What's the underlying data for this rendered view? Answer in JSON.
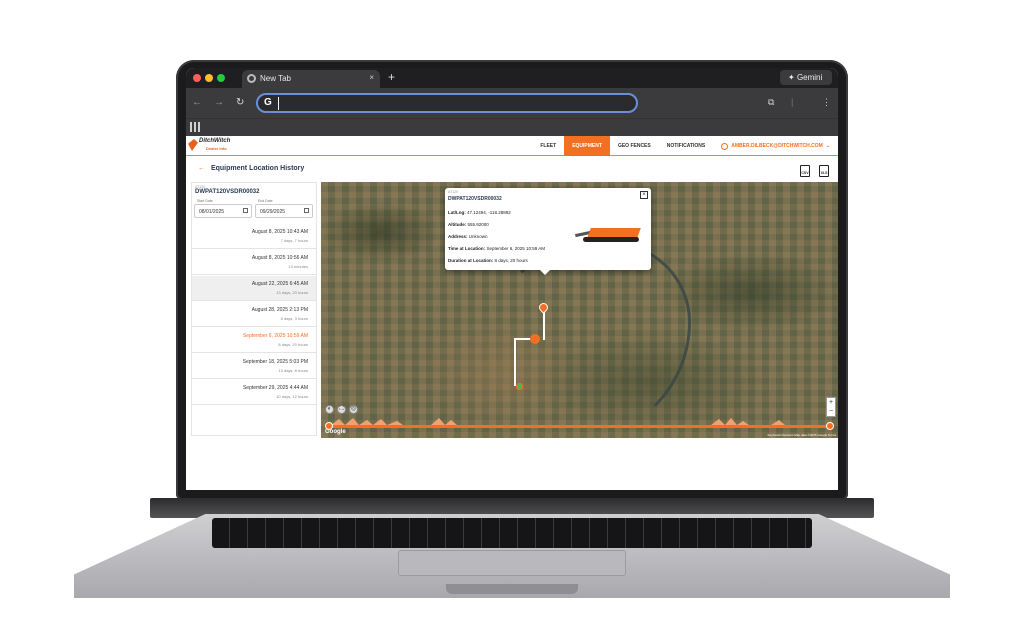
{
  "browser": {
    "tab_title": "New Tab",
    "tab_close": "×",
    "new_tab": "+",
    "gemini_label": "Gemini",
    "omnibox_value": ""
  },
  "app": {
    "logo_name": "DitchWitch",
    "logo_sub": "Dealer Info",
    "nav": {
      "fleet": "FLEET",
      "equipment": "EQUIPMENT",
      "geo_fences": "GEO FENCES",
      "notifications": "NOTIFICATIONS",
      "user_email": "AMBER.DILBECK@DITCHWITCH.COM"
    },
    "page_title": "Equipment Location History",
    "export": {
      "csv": "CSV",
      "xls": "XLS"
    },
    "sidebar": {
      "asset_label": "AT120",
      "asset_id": "DWPAT120VSDR00032",
      "start_date_label": "Start Date",
      "start_date": "08/01/2025",
      "end_date_label": "End Date",
      "end_date": "09/29/2025",
      "rows": [
        {
          "date": "August 8, 2025 10:43 AM",
          "duration": "7 days, 7 hours"
        },
        {
          "date": "August 8, 2025 10:56 AM",
          "duration": "13 minutes"
        },
        {
          "date": "August 22, 2025 6:45 AM",
          "duration": "13 days, 20 hours"
        },
        {
          "date": "August 28, 2025 2:13 PM",
          "duration": "8 days, 3 hours"
        },
        {
          "date": "September 6, 2025 10:59 AM",
          "duration": "8 days, 20 hours"
        },
        {
          "date": "September 18, 2025 5:03 PM",
          "duration": "13 days, 8 hours"
        },
        {
          "date": "September 29, 2025 4:44 AM",
          "duration": "10 days, 12 hours"
        }
      ]
    },
    "popup": {
      "asset_label": "AT120",
      "asset_id": "DWPAT120VSDR00032",
      "latlng_label": "Lat/Lng:",
      "latlng": "47.12494, -118.28892",
      "altitude_label": "Altitude:",
      "altitude": "555.92000",
      "address_label": "Address:",
      "address": "Unknown",
      "time_label": "Time at Location:",
      "time": "September 6, 2025 10:59 AM",
      "duration_label": "Duration at Location:",
      "duration": "8 days, 20 hours",
      "close": "×"
    },
    "map": {
      "google": "Google",
      "attribution": "Keyboard shortcuts   Map data ©2025 Google   Terms",
      "zoom_in": "+",
      "zoom_out": "−"
    }
  },
  "colors": {
    "accent": "#f36f21",
    "navy": "#2a3a52"
  }
}
